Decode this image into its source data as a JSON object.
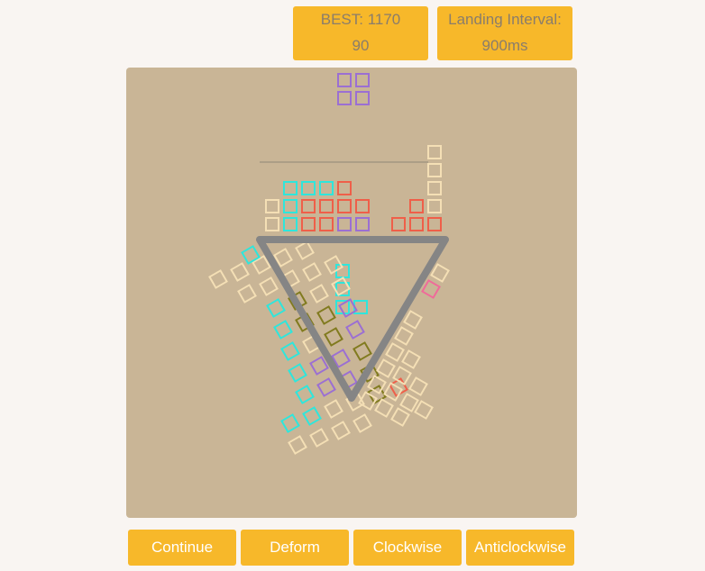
{
  "stats": {
    "best_line1": "BEST: 1170",
    "best_line2": "90",
    "interval_line1": "Landing Interval:",
    "interval_line2": "900ms"
  },
  "buttons": {
    "continue": "Continue",
    "deform": "Deform",
    "clockwise": "Clockwise",
    "anticlockwise": "Anticlockwise"
  },
  "colors": {
    "board": "#c9b596",
    "button": "#f7b82a",
    "triangle": "#858585",
    "block_cream": "#f4dfb5",
    "block_cyan": "#2ee6dc",
    "block_red": "#ef5f49",
    "block_purple": "#9b6fd3",
    "block_olive": "#817b1f",
    "block_pink": "#f06a9a"
  }
}
